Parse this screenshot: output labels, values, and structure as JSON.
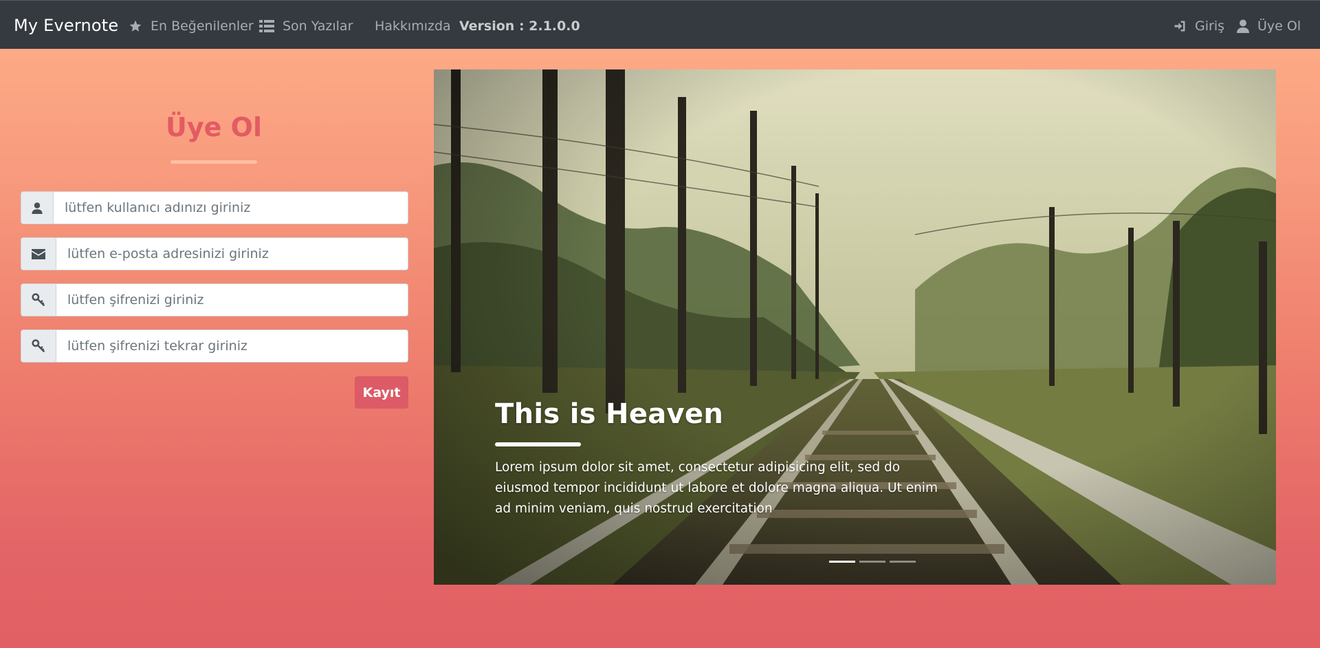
{
  "navbar": {
    "brand": "My Evernote",
    "items": [
      {
        "label": "En Beğenilenler",
        "icon": "star-icon"
      },
      {
        "label": "Son Yazılar",
        "icon": "list-icon"
      },
      {
        "label": "Hakkımızda"
      },
      {
        "label": "Version : 2.1.0.0"
      }
    ],
    "right_items": [
      {
        "label": "Giriş",
        "icon": "sign-in-icon"
      },
      {
        "label": "Üye Ol",
        "icon": "user-icon"
      }
    ]
  },
  "register_form": {
    "title": "Üye Ol",
    "fields": [
      {
        "placeholder": "lütfen kullanıcı adınızı giriniz",
        "value": "",
        "icon": "user-icon"
      },
      {
        "placeholder": "lütfen e-posta adresinizi giriniz",
        "value": "",
        "icon": "envelope-icon"
      },
      {
        "placeholder": "lütfen şifrenizi giriniz",
        "value": "",
        "icon": "key-icon"
      },
      {
        "placeholder": "lütfen şifrenizi tekrar giriniz",
        "value": "",
        "icon": "key-icon"
      }
    ],
    "submit_label": "Kayıt"
  },
  "carousel": {
    "caption_title": "This is Heaven",
    "caption_text": "Lorem ipsum dolor sit amet, consectetur adipisicing elit, sed do eiusmod tempor incididunt ut labore et dolore magna aliqua. Ut enim ad minim veniam, quis nostrud exercitation",
    "slide_count": 3,
    "active_slide": 1
  },
  "colors": {
    "navbar_bg": "#343a40",
    "accent": "#dc5b66",
    "title": "#e35b63",
    "gradient_top": "#ffb089",
    "gradient_bottom": "#e06063"
  }
}
